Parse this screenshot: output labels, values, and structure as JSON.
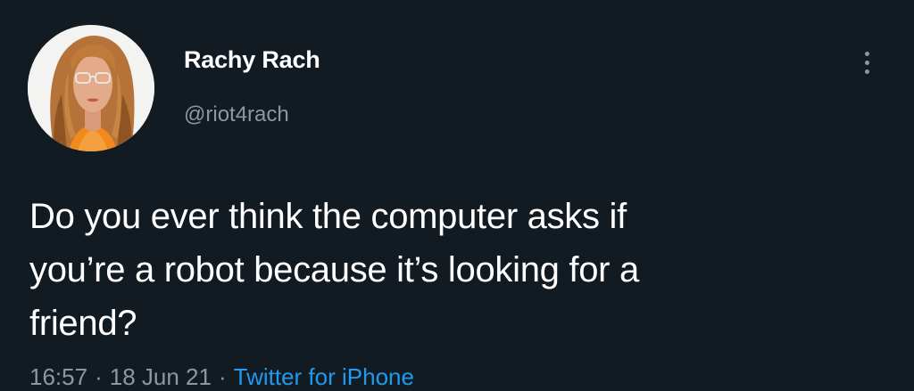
{
  "tweet": {
    "author": {
      "display_name": "Rachy Rach",
      "handle": "@riot4rach",
      "avatar_icon": "profile-photo"
    },
    "text_lines": [
      "Do you ever think the computer asks if",
      "you’re a robot because it’s looking for a",
      "friend?"
    ],
    "time": "16:57",
    "date": "18 Jun 21",
    "separator": "·",
    "source": "Twitter for iPhone",
    "more_icon": "more-vertical-icon"
  },
  "colors": {
    "background": "#131b22",
    "text_primary": "#ffffff",
    "text_secondary": "#8b98a5",
    "accent": "#1d9bf0"
  }
}
